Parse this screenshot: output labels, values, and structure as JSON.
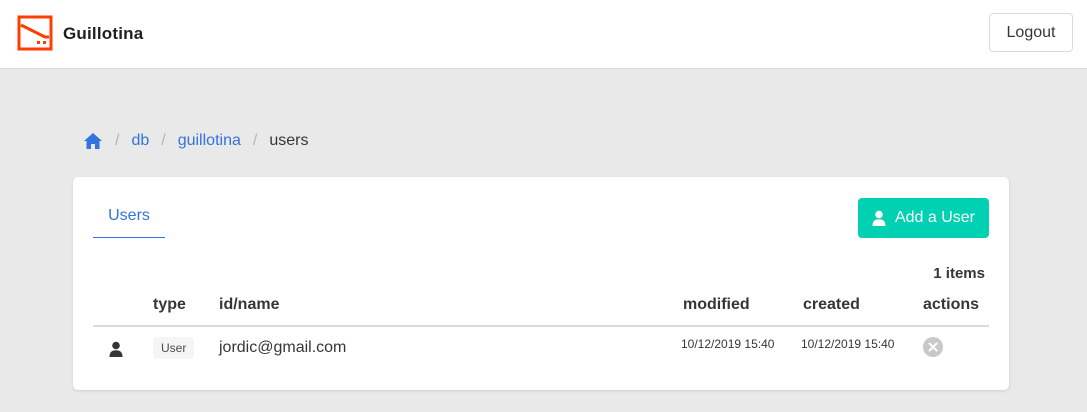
{
  "header": {
    "brand": "Guillotina",
    "logout_label": "Logout",
    "logo_icon": "guillotina-logo-icon",
    "accent_color": "#ff3d00"
  },
  "breadcrumb": {
    "home_icon": "home-icon",
    "items": [
      "db",
      "guillotina"
    ],
    "current": "users",
    "separator": "/"
  },
  "card": {
    "tabs": [
      {
        "label": "Users",
        "active": true
      }
    ],
    "add_user_label": "Add a User",
    "add_user_icon": "user-icon",
    "item_count": "1 items",
    "table": {
      "columns": [
        "type",
        "id/name",
        "modified",
        "created",
        "actions"
      ],
      "rows": [
        {
          "type_icon": "user-icon",
          "type": "User",
          "id": "jordic@gmail.com",
          "modified": "10/12/2019 15:40",
          "created": "10/12/2019 15:40",
          "action_icon": "delete-icon"
        }
      ]
    }
  },
  "colors": {
    "link": "#3273dc",
    "primary_button": "#00d1b2",
    "background": "#e9e9e9"
  }
}
